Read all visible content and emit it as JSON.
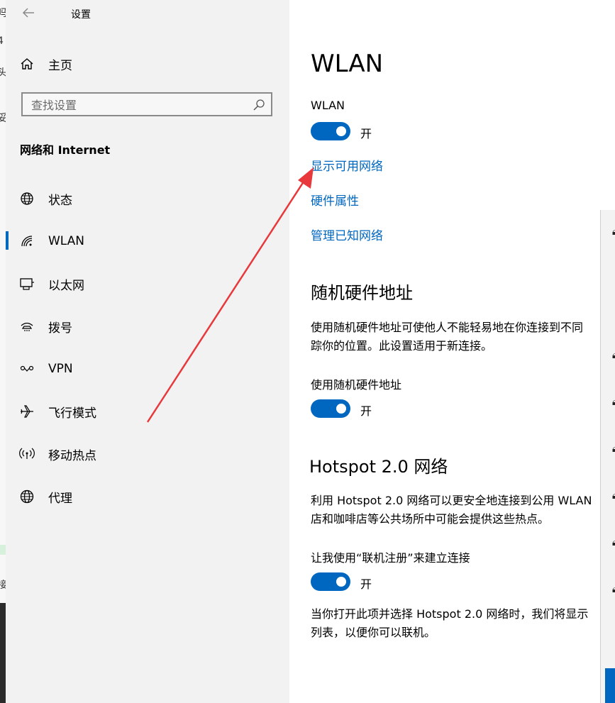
{
  "window": {
    "title": "设置"
  },
  "sidebar": {
    "home_label": "主页",
    "search": {
      "placeholder": "查找设置"
    },
    "section_title": "网络和 Internet",
    "items": [
      {
        "label": "状态",
        "icon": "globe-status-icon"
      },
      {
        "label": "WLAN",
        "icon": "wifi-icon",
        "active": true
      },
      {
        "label": "以太网",
        "icon": "ethernet-icon"
      },
      {
        "label": "拨号",
        "icon": "dialup-icon"
      },
      {
        "label": "VPN",
        "icon": "vpn-icon"
      },
      {
        "label": "飞行模式",
        "icon": "airplane-icon"
      },
      {
        "label": "移动热点",
        "icon": "hotspot-icon"
      },
      {
        "label": "代理",
        "icon": "globe-proxy-icon"
      }
    ]
  },
  "main": {
    "title": "WLAN",
    "wlan": {
      "label": "WLAN",
      "toggle_text": "开",
      "on": true
    },
    "links": {
      "show_networks": "显示可用网络",
      "hardware_props": "硬件属性",
      "manage_known": "管理已知网络"
    },
    "random_mac": {
      "heading": "随机硬件地址",
      "desc_line1": "使用随机硬件地址可使他人不能轻易地在你连接到不同",
      "desc_line2": "踪你的位置。此设置适用于新连接。",
      "toggle_label": "使用随机硬件地址",
      "toggle_text": "开",
      "on": true
    },
    "hotspot": {
      "heading": "Hotspot 2.0 网络",
      "desc_line1": "利用 Hotspot 2.0 网络可以更安全地连接到公用 WLAN",
      "desc_line2": "店和咖啡店等公共场所中可能会提供这些热点。",
      "toggle_label": "让我使用“联机注册”来建立连接",
      "toggle_text": "开",
      "on": true,
      "note_line1": "当你打开此项并选择 Hotspot 2.0 网络时，我们将显示",
      "note_line2": "列表，以便你可以联机。"
    }
  },
  "colors": {
    "accent": "#0067c0",
    "sidebar_bg": "#f2f2f2",
    "arrow": "#e8383b"
  }
}
